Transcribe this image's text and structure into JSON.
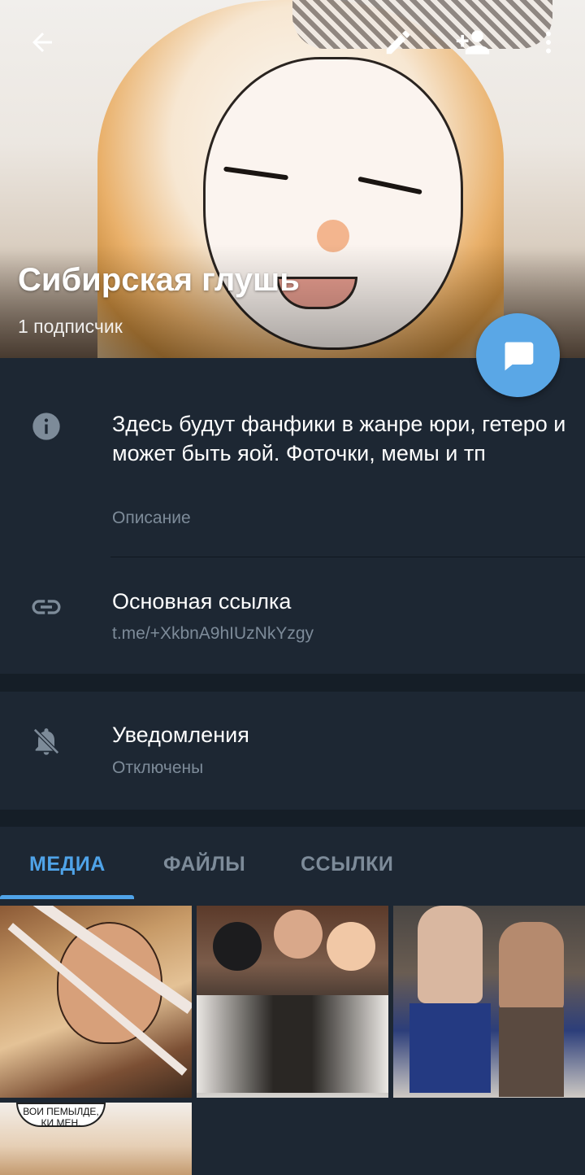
{
  "channel": {
    "title": "Сибирская глушь",
    "subscribers": "1 подписчик"
  },
  "topbar": {
    "back_icon": "arrow-left-icon",
    "edit_icon": "pencil-icon",
    "add_member_icon": "add-person-icon",
    "more_icon": "more-vertical-icon"
  },
  "fab": {
    "icon": "chat-bubble-icon"
  },
  "description": {
    "text": "Здесь будут фанфики в жанре юри, гетеро и может быть яой. Фоточки, мемы и тп",
    "label": "Описание",
    "icon": "info-icon"
  },
  "link": {
    "title": "Основная ссылка",
    "value": "t.me/+XkbnA9hIUzNkYzgy",
    "icon": "link-icon"
  },
  "notifications": {
    "title": "Уведомления",
    "value": "Отключены",
    "icon": "bell-off-icon"
  },
  "tabs": [
    {
      "label": "МЕДИА",
      "active": true
    },
    {
      "label": "ФАЙЛЫ",
      "active": false
    },
    {
      "label": "ССЫЛКИ",
      "active": false
    }
  ],
  "media_caption": "ВОИ ПЕМЫЛДЕ, КИ МЕН.",
  "colors": {
    "background": "#1d2733",
    "section_gap": "#151e27",
    "accent": "#4fa3e8",
    "fab": "#5aa7e6",
    "secondary_text": "#7d8b99"
  }
}
